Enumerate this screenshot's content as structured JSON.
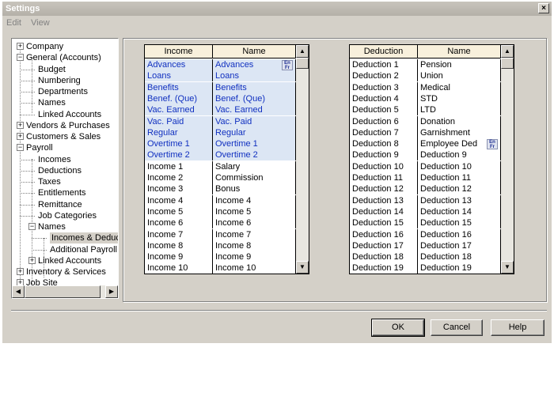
{
  "window": {
    "title": "Settings",
    "close_glyph": "×"
  },
  "menu": [
    "Edit",
    "View"
  ],
  "tree": [
    {
      "label": "Company",
      "level": 0,
      "expander": "+"
    },
    {
      "label": "General (Accounts)",
      "level": 0,
      "expander": "−"
    },
    {
      "label": "Budget",
      "level": 1
    },
    {
      "label": "Numbering",
      "level": 1
    },
    {
      "label": "Departments",
      "level": 1
    },
    {
      "label": "Names",
      "level": 1
    },
    {
      "label": "Linked Accounts",
      "level": 1
    },
    {
      "label": "Vendors & Purchases",
      "level": 0,
      "expander": "+"
    },
    {
      "label": "Customers & Sales",
      "level": 0,
      "expander": "+"
    },
    {
      "label": "Payroll",
      "level": 0,
      "expander": "−"
    },
    {
      "label": "Incomes",
      "level": 1
    },
    {
      "label": "Deductions",
      "level": 1
    },
    {
      "label": "Taxes",
      "level": 1
    },
    {
      "label": "Entitlements",
      "level": 1
    },
    {
      "label": "Remittance",
      "level": 1
    },
    {
      "label": "Job Categories",
      "level": 1
    },
    {
      "label": "Names",
      "level": 1,
      "expander": "−"
    },
    {
      "label": "Incomes & Deduc",
      "level": 2,
      "selected": true
    },
    {
      "label": "Additional Payroll",
      "level": 2
    },
    {
      "label": "Linked Accounts",
      "level": 1,
      "expander": "+"
    },
    {
      "label": "Inventory & Services",
      "level": 0,
      "expander": "+"
    },
    {
      "label": "Job Site",
      "level": 0,
      "expander": "+"
    }
  ],
  "income_table": {
    "headers": [
      "Income",
      "Name"
    ],
    "rows": [
      [
        "Advances",
        "Advances",
        true
      ],
      [
        "Loans",
        "Loans",
        true
      ],
      [
        "Benefits",
        "Benefits",
        true
      ],
      [
        "Benef. (Que)",
        "Benef. (Que)",
        true
      ],
      [
        "Vac. Earned",
        "Vac. Earned",
        true
      ],
      [
        "Vac. Paid",
        "Vac. Paid",
        true
      ],
      [
        "Regular",
        "Regular",
        true
      ],
      [
        "Overtime 1",
        "Overtime 1",
        true
      ],
      [
        "Overtime 2",
        "Overtime 2",
        true
      ],
      [
        "Income 1",
        "Salary",
        false
      ],
      [
        "Income 2",
        "Commission",
        false
      ],
      [
        "Income 3",
        "Bonus",
        false
      ],
      [
        "Income 4",
        "Income 4",
        false
      ],
      [
        "Income 5",
        "Income 5",
        false
      ],
      [
        "Income 6",
        "Income 6",
        false
      ],
      [
        "Income 7",
        "Income 7",
        false
      ],
      [
        "Income 8",
        "Income 8",
        false
      ],
      [
        "Income 9",
        "Income 9",
        false
      ],
      [
        "Income 10",
        "Income 10",
        false
      ]
    ],
    "lang_icon_text": "En Fr"
  },
  "deduction_table": {
    "headers": [
      "Deduction",
      "Name"
    ],
    "rows": [
      [
        "Deduction 1",
        "Pension"
      ],
      [
        "Deduction 2",
        "Union"
      ],
      [
        "Deduction 3",
        "Medical"
      ],
      [
        "Deduction 4",
        "STD"
      ],
      [
        "Deduction 5",
        "LTD"
      ],
      [
        "Deduction 6",
        "Donation"
      ],
      [
        "Deduction 7",
        "Garnishment"
      ],
      [
        "Deduction 8",
        "Employee Ded"
      ],
      [
        "Deduction 9",
        "Deduction 9"
      ],
      [
        "Deduction 10",
        "Deduction 10"
      ],
      [
        "Deduction 11",
        "Deduction 11"
      ],
      [
        "Deduction 12",
        "Deduction 12"
      ],
      [
        "Deduction 13",
        "Deduction 13"
      ],
      [
        "Deduction 14",
        "Deduction 14"
      ],
      [
        "Deduction 15",
        "Deduction 15"
      ],
      [
        "Deduction 16",
        "Deduction 16"
      ],
      [
        "Deduction 17",
        "Deduction 17"
      ],
      [
        "Deduction 18",
        "Deduction 18"
      ],
      [
        "Deduction 19",
        "Deduction 19"
      ]
    ],
    "lang_icon_text": "En Fr"
  },
  "buttons": {
    "ok": "OK",
    "cancel": "Cancel",
    "help": "Help"
  },
  "scroll_glyphs": {
    "up": "▲",
    "down": "▼",
    "left": "◀",
    "right": "▶"
  }
}
